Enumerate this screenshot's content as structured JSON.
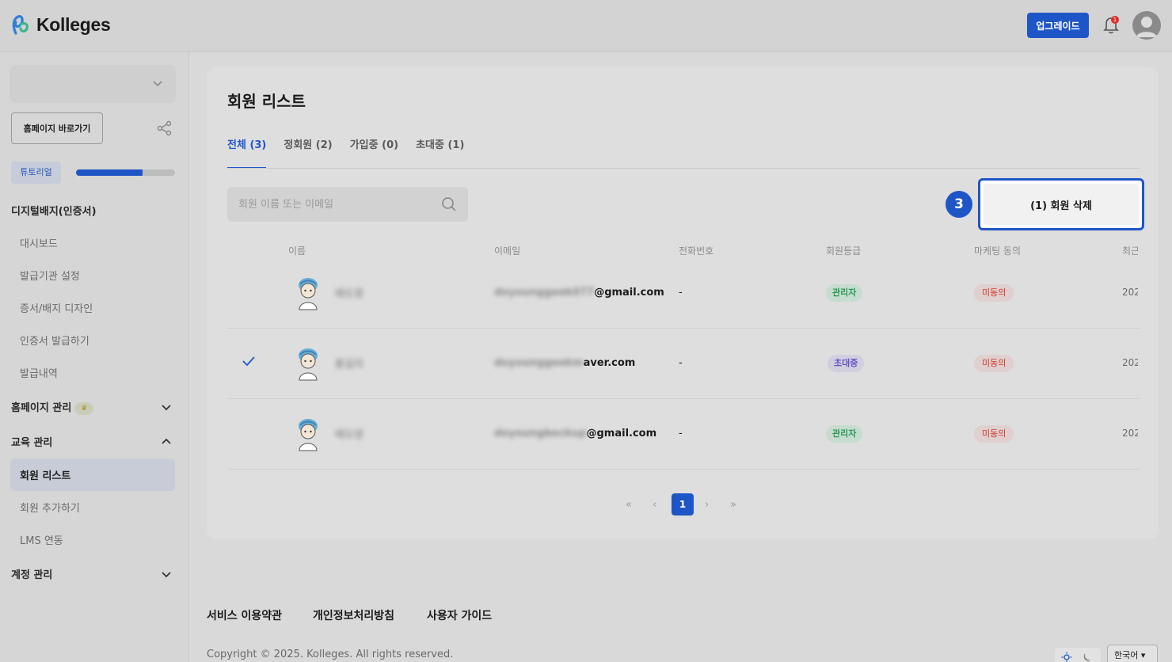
{
  "app": {
    "name": "Kolleges",
    "upgrade_label": "업그레이드",
    "notification_count": "1",
    "colors": {
      "accent": "#1f56c7",
      "success": "#2e9a5a",
      "danger": "#d23a2e",
      "purple": "#6a52c7"
    }
  },
  "sidebar": {
    "workspace_value": "",
    "home_button_label": "홈페이지 바로가기",
    "tutorial_label": "튜토리얼",
    "tutorial_progress": 0.67,
    "sections": [
      {
        "label": "디지털배지(인증서)"
      },
      {
        "label": "홈페이지 관리",
        "badge_icon": "crown-icon"
      },
      {
        "label": "교육 관리"
      },
      {
        "label": "계정 관리"
      }
    ],
    "badge_items": [
      "대시보드",
      "발급기관 설정",
      "증서/배지 디자인",
      "인증서 발급하기",
      "발급내역"
    ],
    "edu_items": [
      "회원 리스트",
      "회원 추가하기",
      "LMS 연동"
    ]
  },
  "main": {
    "title": "회원 리스트",
    "tabs": [
      "전체 (3)",
      "정회원 (2)",
      "가입중 (0)",
      "초대중 (1)"
    ],
    "search_placeholder": "회원 이름 또는 이메일",
    "delete_button_label": "(1) 회원 삭제",
    "step_number": "3",
    "columns": [
      "이름",
      "이메일",
      "전화번호",
      "회원등급",
      "마케팅 동의",
      "최근"
    ],
    "rows": [
      {
        "name": "배도영",
        "email_hidden": "doyounggeek077",
        "email_visible": "@gmail.com",
        "phone": "-",
        "role": "관리자",
        "marketing": "미동의",
        "date": "202",
        "selected": false
      },
      {
        "name": "홍길자",
        "email_hidden": "doyounggeekm",
        "email_visible": "aver.com",
        "phone": "-",
        "role": "초대중",
        "marketing": "미동의",
        "date": "202",
        "selected": true
      },
      {
        "name": "배도영",
        "email_hidden": "doyoungbeckup",
        "email_visible": "@gmail.com",
        "phone": "-",
        "role": "관리자",
        "marketing": "미동의",
        "date": "202",
        "selected": false
      }
    ],
    "pagination": {
      "first": "«",
      "prev": "‹",
      "current": "1",
      "next": "›",
      "last": "»"
    }
  },
  "footer": {
    "links": [
      "서비스 이용약관",
      "개인정보처리방침",
      "사용자 가이드"
    ],
    "copyright": "Copyright © 2025. Kolleges. All rights reserved.",
    "language": "한국어"
  }
}
